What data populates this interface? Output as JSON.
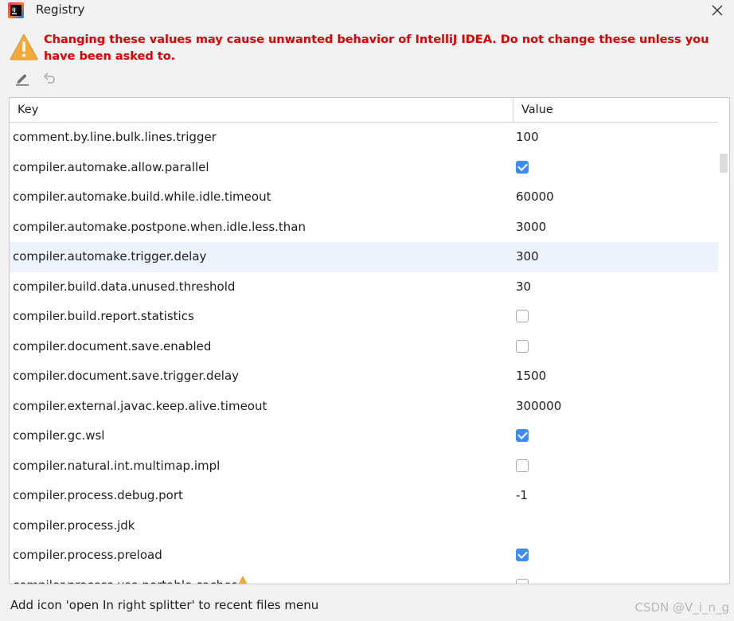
{
  "window": {
    "title": "Registry"
  },
  "warning": {
    "text": "Changing these values may cause unwanted behavior of IntelliJ IDEA. Do not change these unless you have been asked to."
  },
  "table": {
    "headers": {
      "key": "Key",
      "value": "Value"
    },
    "rows": [
      {
        "key": "comment.by.line.bulk.lines.trigger",
        "type": "text",
        "value": "100"
      },
      {
        "key": "compiler.automake.allow.parallel",
        "type": "checkbox",
        "checked": true
      },
      {
        "key": "compiler.automake.build.while.idle.timeout",
        "type": "text",
        "value": "60000"
      },
      {
        "key": "compiler.automake.postpone.when.idle.less.than",
        "type": "text",
        "value": "3000"
      },
      {
        "key": "compiler.automake.trigger.delay",
        "type": "text",
        "value": "300",
        "selected": true
      },
      {
        "key": "compiler.build.data.unused.threshold",
        "type": "text",
        "value": "30"
      },
      {
        "key": "compiler.build.report.statistics",
        "type": "checkbox",
        "checked": false
      },
      {
        "key": "compiler.document.save.enabled",
        "type": "checkbox",
        "checked": false
      },
      {
        "key": "compiler.document.save.trigger.delay",
        "type": "text",
        "value": "1500"
      },
      {
        "key": "compiler.external.javac.keep.alive.timeout",
        "type": "text",
        "value": "300000"
      },
      {
        "key": "compiler.gc.wsl",
        "type": "checkbox",
        "checked": true
      },
      {
        "key": "compiler.natural.int.multimap.impl",
        "type": "checkbox",
        "checked": false
      },
      {
        "key": "compiler.process.debug.port",
        "type": "text",
        "value": "-1"
      },
      {
        "key": "compiler.process.jdk",
        "type": "text",
        "value": ""
      },
      {
        "key": "compiler.process.preload",
        "type": "checkbox",
        "checked": true
      },
      {
        "key": "compiler.process.use.portable.caches",
        "type": "checkbox",
        "checked": false,
        "partial": true
      }
    ]
  },
  "status": {
    "description": "Add icon 'open In right splitter' to recent files menu"
  },
  "watermark": "CSDN @V_i_n_g",
  "colors": {
    "warning_text": "#e00000",
    "checkbox_accent": "#3d8bf5",
    "selected_row": "#edf3fb"
  }
}
